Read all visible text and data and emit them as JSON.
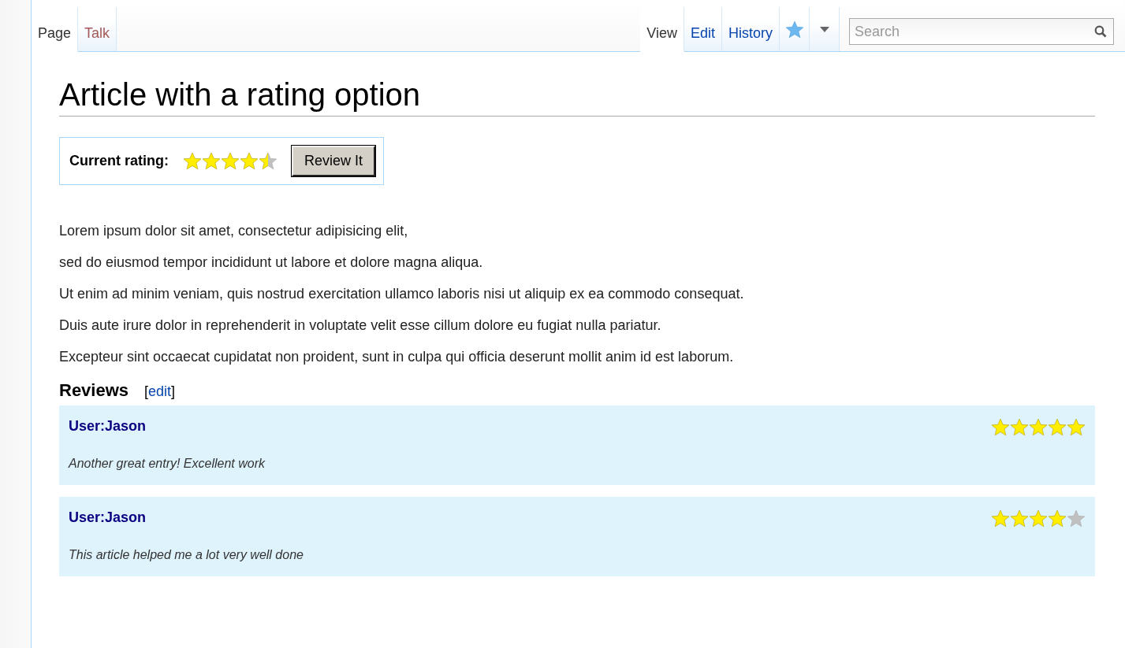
{
  "left_tabs": [
    {
      "label": "Page",
      "selected": true
    },
    {
      "label": "Talk",
      "selected": false
    }
  ],
  "right_tabs": [
    {
      "label": "View",
      "selected": true
    },
    {
      "label": "Edit",
      "selected": false
    },
    {
      "label": "History",
      "selected": false
    }
  ],
  "search": {
    "placeholder": "Search"
  },
  "title": "Article with a rating option",
  "rating": {
    "label": "Current rating:",
    "stars": 4.5,
    "button": "Review It"
  },
  "paragraphs": [
    "Lorem ipsum dolor sit amet, consectetur adipisicing elit,",
    "sed do eiusmod tempor incididunt ut labore et dolore magna aliqua.",
    "Ut enim ad minim veniam, quis nostrud exercitation ullamco laboris nisi ut aliquip ex ea commodo consequat.",
    "Duis aute irure dolor in reprehenderit in voluptate velit esse cillum dolore eu fugiat nulla pariatur.",
    "Excepteur sint occaecat cupidatat non proident, sunt in culpa qui officia deserunt mollit anim id est laborum."
  ],
  "reviews_heading": {
    "title": "Reviews",
    "open_bracket": "[",
    "edit_link": "edit",
    "close_bracket": "]"
  },
  "reviews": [
    {
      "user": "User:Jason",
      "stars": 5,
      "comment": "Another great entry! Excellent work"
    },
    {
      "user": "User:Jason",
      "stars": 4,
      "comment": "This article helped me a lot very well done"
    }
  ]
}
